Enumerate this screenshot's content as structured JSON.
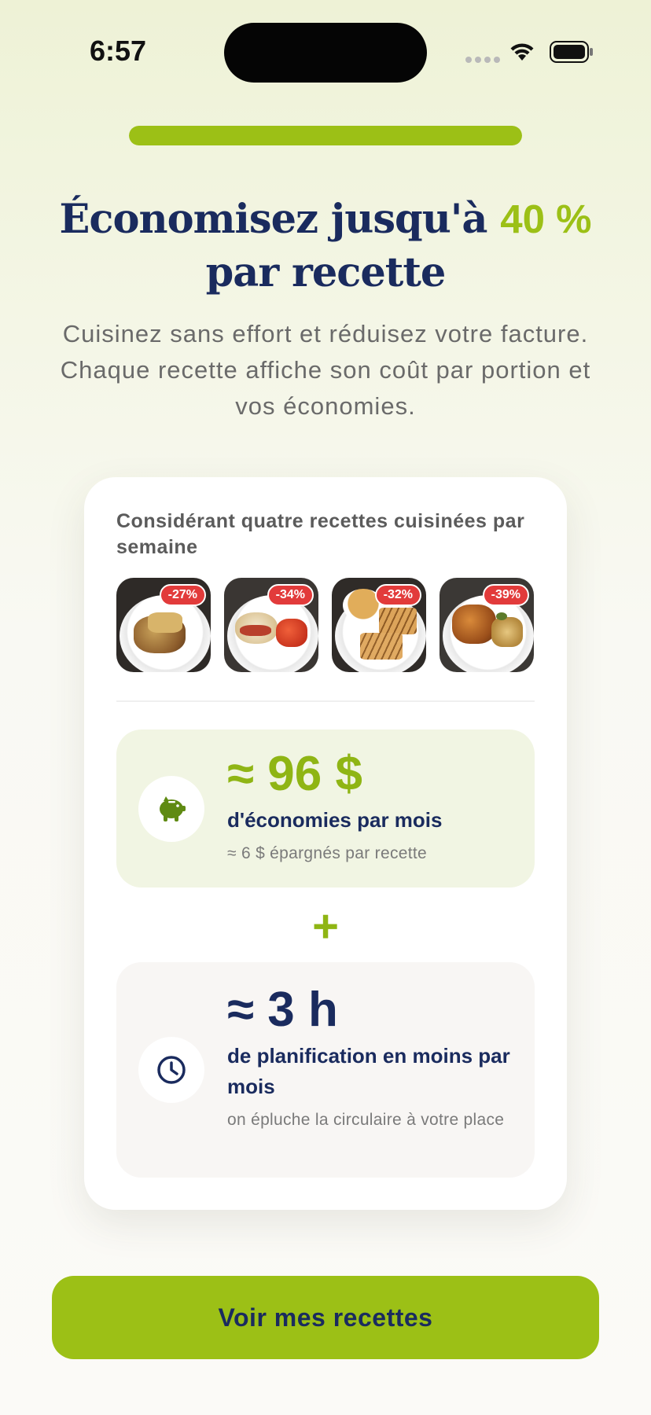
{
  "status_bar": {
    "time": "6:57",
    "icons": [
      "cellular-signal-icon",
      "wifi-icon",
      "battery-icon"
    ]
  },
  "onboarding_progress": 1.0,
  "headline": {
    "text_before": "Économisez jusqu'à ",
    "highlight": "40 %",
    "text_after": "par recette"
  },
  "subtitle": "Cuisinez sans effort et réduisez votre facture. Chaque recette affiche son coût par portion et vos économies.",
  "card": {
    "caption": "Considérant quatre recettes cuisinées par semaine",
    "recipes": [
      {
        "badge": "-27%",
        "dish": "shepherds-pie"
      },
      {
        "badge": "-34%",
        "dish": "sandwich-with-tomatoes"
      },
      {
        "badge": "-32%",
        "dish": "soup-and-grilled-cheese"
      },
      {
        "badge": "-39%",
        "dish": "roast-chicken-and-potatoes"
      }
    ],
    "savings": {
      "icon": "piggy-bank-icon",
      "value": "≈ 96 $",
      "label": "d'économies par mois",
      "note": "≈ 6 $ épargnés par recette"
    },
    "plus": "+",
    "time": {
      "icon": "clock-icon",
      "value": "≈ 3 h",
      "label": "de planification en moins par mois",
      "note": "on épluche la circulaire à votre place"
    }
  },
  "cta": {
    "label": "Voir mes recettes"
  },
  "colors": {
    "accent_green": "#9cc016",
    "navy": "#1a2b5e",
    "badge_red": "#e23b3b",
    "savings_bg": "#f1f5e3",
    "time_bg": "#f8f6f4"
  }
}
